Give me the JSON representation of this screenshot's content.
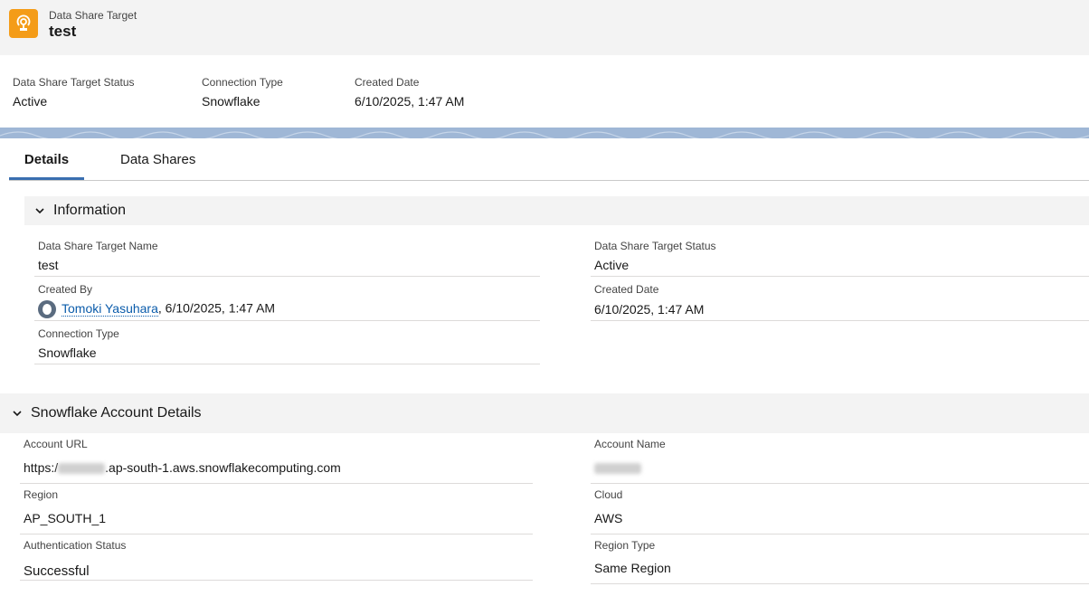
{
  "header": {
    "object_type": "Data Share Target",
    "record_name": "test",
    "icon": "data-share-target-icon"
  },
  "highlights": [
    {
      "label": "Data Share Target Status",
      "value": "Active"
    },
    {
      "label": "Connection Type",
      "value": "Snowflake"
    },
    {
      "label": "Created Date",
      "value": "6/10/2025, 1:47 AM"
    }
  ],
  "tabs": [
    {
      "label": "Details",
      "active": true
    },
    {
      "label": "Data Shares",
      "active": false
    }
  ],
  "information": {
    "title": "Information",
    "fields": {
      "name": {
        "label": "Data Share Target Name",
        "value": "test"
      },
      "status": {
        "label": "Data Share Target Status",
        "value": "Active"
      },
      "created_by": {
        "label": "Created By",
        "user": "Tomoki Yasuhara",
        "date": ", 6/10/2025, 1:47 AM"
      },
      "created_date": {
        "label": "Created Date",
        "value": "6/10/2025, 1:47 AM"
      },
      "connection_type": {
        "label": "Connection Type",
        "value": "Snowflake"
      }
    }
  },
  "snowflake": {
    "title": "Snowflake Account Details",
    "fields": {
      "account_url": {
        "label": "Account URL",
        "prefix": "https:/",
        "suffix": ".ap-south-1.aws.snowflakecomputing.com"
      },
      "account_name": {
        "label": "Account Name"
      },
      "region": {
        "label": "Region",
        "value": "AP_SOUTH_1"
      },
      "cloud": {
        "label": "Cloud",
        "value": "AWS"
      },
      "auth_status": {
        "label": "Authentication Status",
        "value": "Successful"
      },
      "region_type": {
        "label": "Region Type",
        "value": "Same Region"
      }
    }
  },
  "colors": {
    "accent": "#3a6fb0",
    "icon_bg": "#f49c18",
    "link": "#0b5cab"
  }
}
